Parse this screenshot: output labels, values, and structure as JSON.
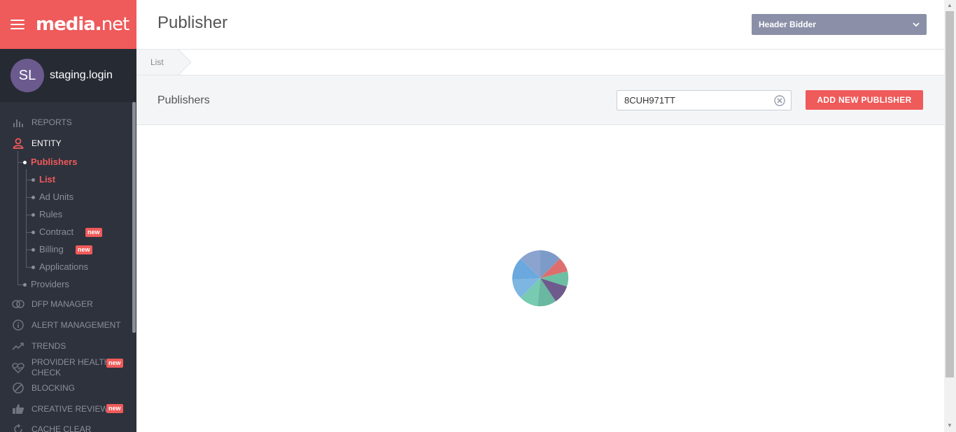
{
  "brand": {
    "logo_main": "media",
    "logo_dot": ".",
    "logo_tail": "net",
    "accent": "#ef5a5a"
  },
  "user": {
    "initials": "SL",
    "name": "staging.login"
  },
  "nav": {
    "reports": "REPORTS",
    "entity": "ENTITY",
    "publishers": "Publishers",
    "sub": {
      "list": "List",
      "ad_units": "Ad Units",
      "rules": "Rules",
      "contract": "Contract",
      "billing": "Billing",
      "applications": "Applications"
    },
    "providers": "Providers",
    "dfp_manager": "DFP MANAGER",
    "alert_management": "ALERT MANAGEMENT",
    "trends": "TRENDS",
    "provider_health_1": "PROVIDER HEALTH",
    "provider_health_2": "CHECK",
    "blocking": "BLOCKING",
    "creative_review": "CREATIVE REVIEW",
    "cache_clear": "CACHE CLEAR",
    "badge_new": "new"
  },
  "header": {
    "title": "Publisher",
    "bidder_select": "Header Bidder"
  },
  "breadcrumb": {
    "item": "List"
  },
  "toolbar": {
    "section_title": "Publishers",
    "search_value": "8CUH971TT",
    "add_button": "ADD NEW PUBLISHER"
  }
}
